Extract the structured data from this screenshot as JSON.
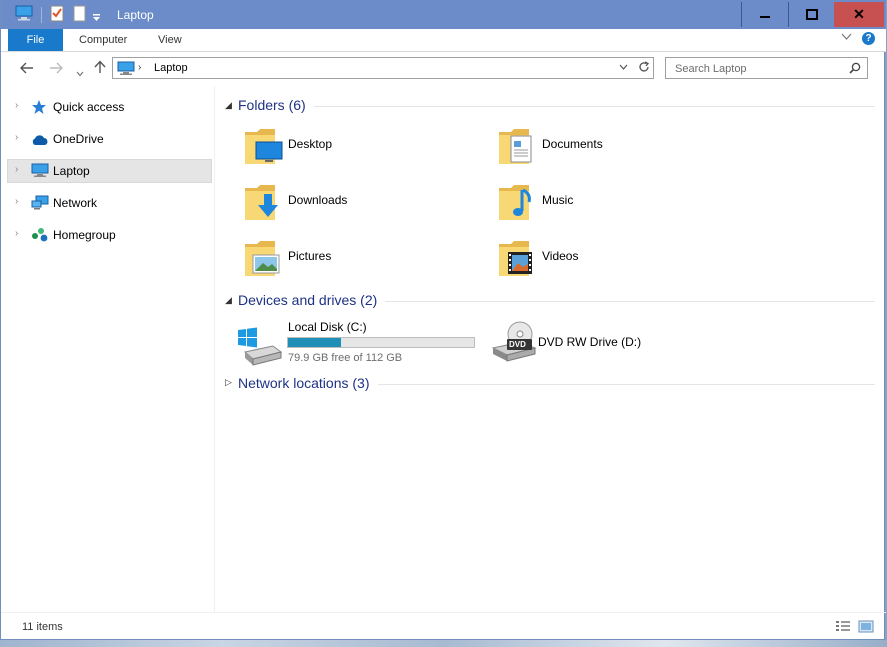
{
  "window": {
    "title": "Laptop"
  },
  "titlebar": {
    "icons": [
      "computer-icon",
      "properties-icon",
      "new-folder-icon",
      "customize-dropdown-icon"
    ],
    "controls": {
      "minimize": "minimize-icon",
      "maximize": "maximize-icon",
      "close": "✕"
    }
  },
  "ribbon": {
    "tabs": [
      {
        "label": "File"
      },
      {
        "label": "Computer"
      },
      {
        "label": "View"
      }
    ],
    "help": "?"
  },
  "nav": {
    "breadcrumb_sep": "›",
    "location": "Laptop",
    "search_placeholder": "Search Laptop"
  },
  "sidebar": {
    "items": [
      {
        "label": "Quick access",
        "icon": "star-icon"
      },
      {
        "label": "OneDrive",
        "icon": "cloud-icon"
      },
      {
        "label": "Laptop",
        "icon": "computer-icon",
        "selected": true
      },
      {
        "label": "Network",
        "icon": "network-icon"
      },
      {
        "label": "Homegroup",
        "icon": "homegroup-icon"
      }
    ]
  },
  "content": {
    "folders_header": "Folders (6)",
    "folders": [
      {
        "label": "Desktop",
        "overlay": "desktop"
      },
      {
        "label": "Documents",
        "overlay": "documents"
      },
      {
        "label": "Downloads",
        "overlay": "downloads"
      },
      {
        "label": "Music",
        "overlay": "music"
      },
      {
        "label": "Pictures",
        "overlay": "pictures"
      },
      {
        "label": "Videos",
        "overlay": "videos"
      }
    ],
    "devices_header": "Devices and drives (2)",
    "drives": [
      {
        "label": "Local Disk (C:)",
        "free_text": "79.9 GB free of 112 GB",
        "used_fraction": 0.287
      },
      {
        "label": "DVD RW Drive (D:)",
        "badge": "DVD"
      }
    ],
    "network_header": "Network locations (3)"
  },
  "status": {
    "count": "11 items"
  },
  "colors": {
    "titlebar": "#6b8cc8",
    "file_tab": "#1979ca",
    "close": "#c75050",
    "header_text": "#1e3287",
    "disk_bar": "#1f8fb8"
  }
}
